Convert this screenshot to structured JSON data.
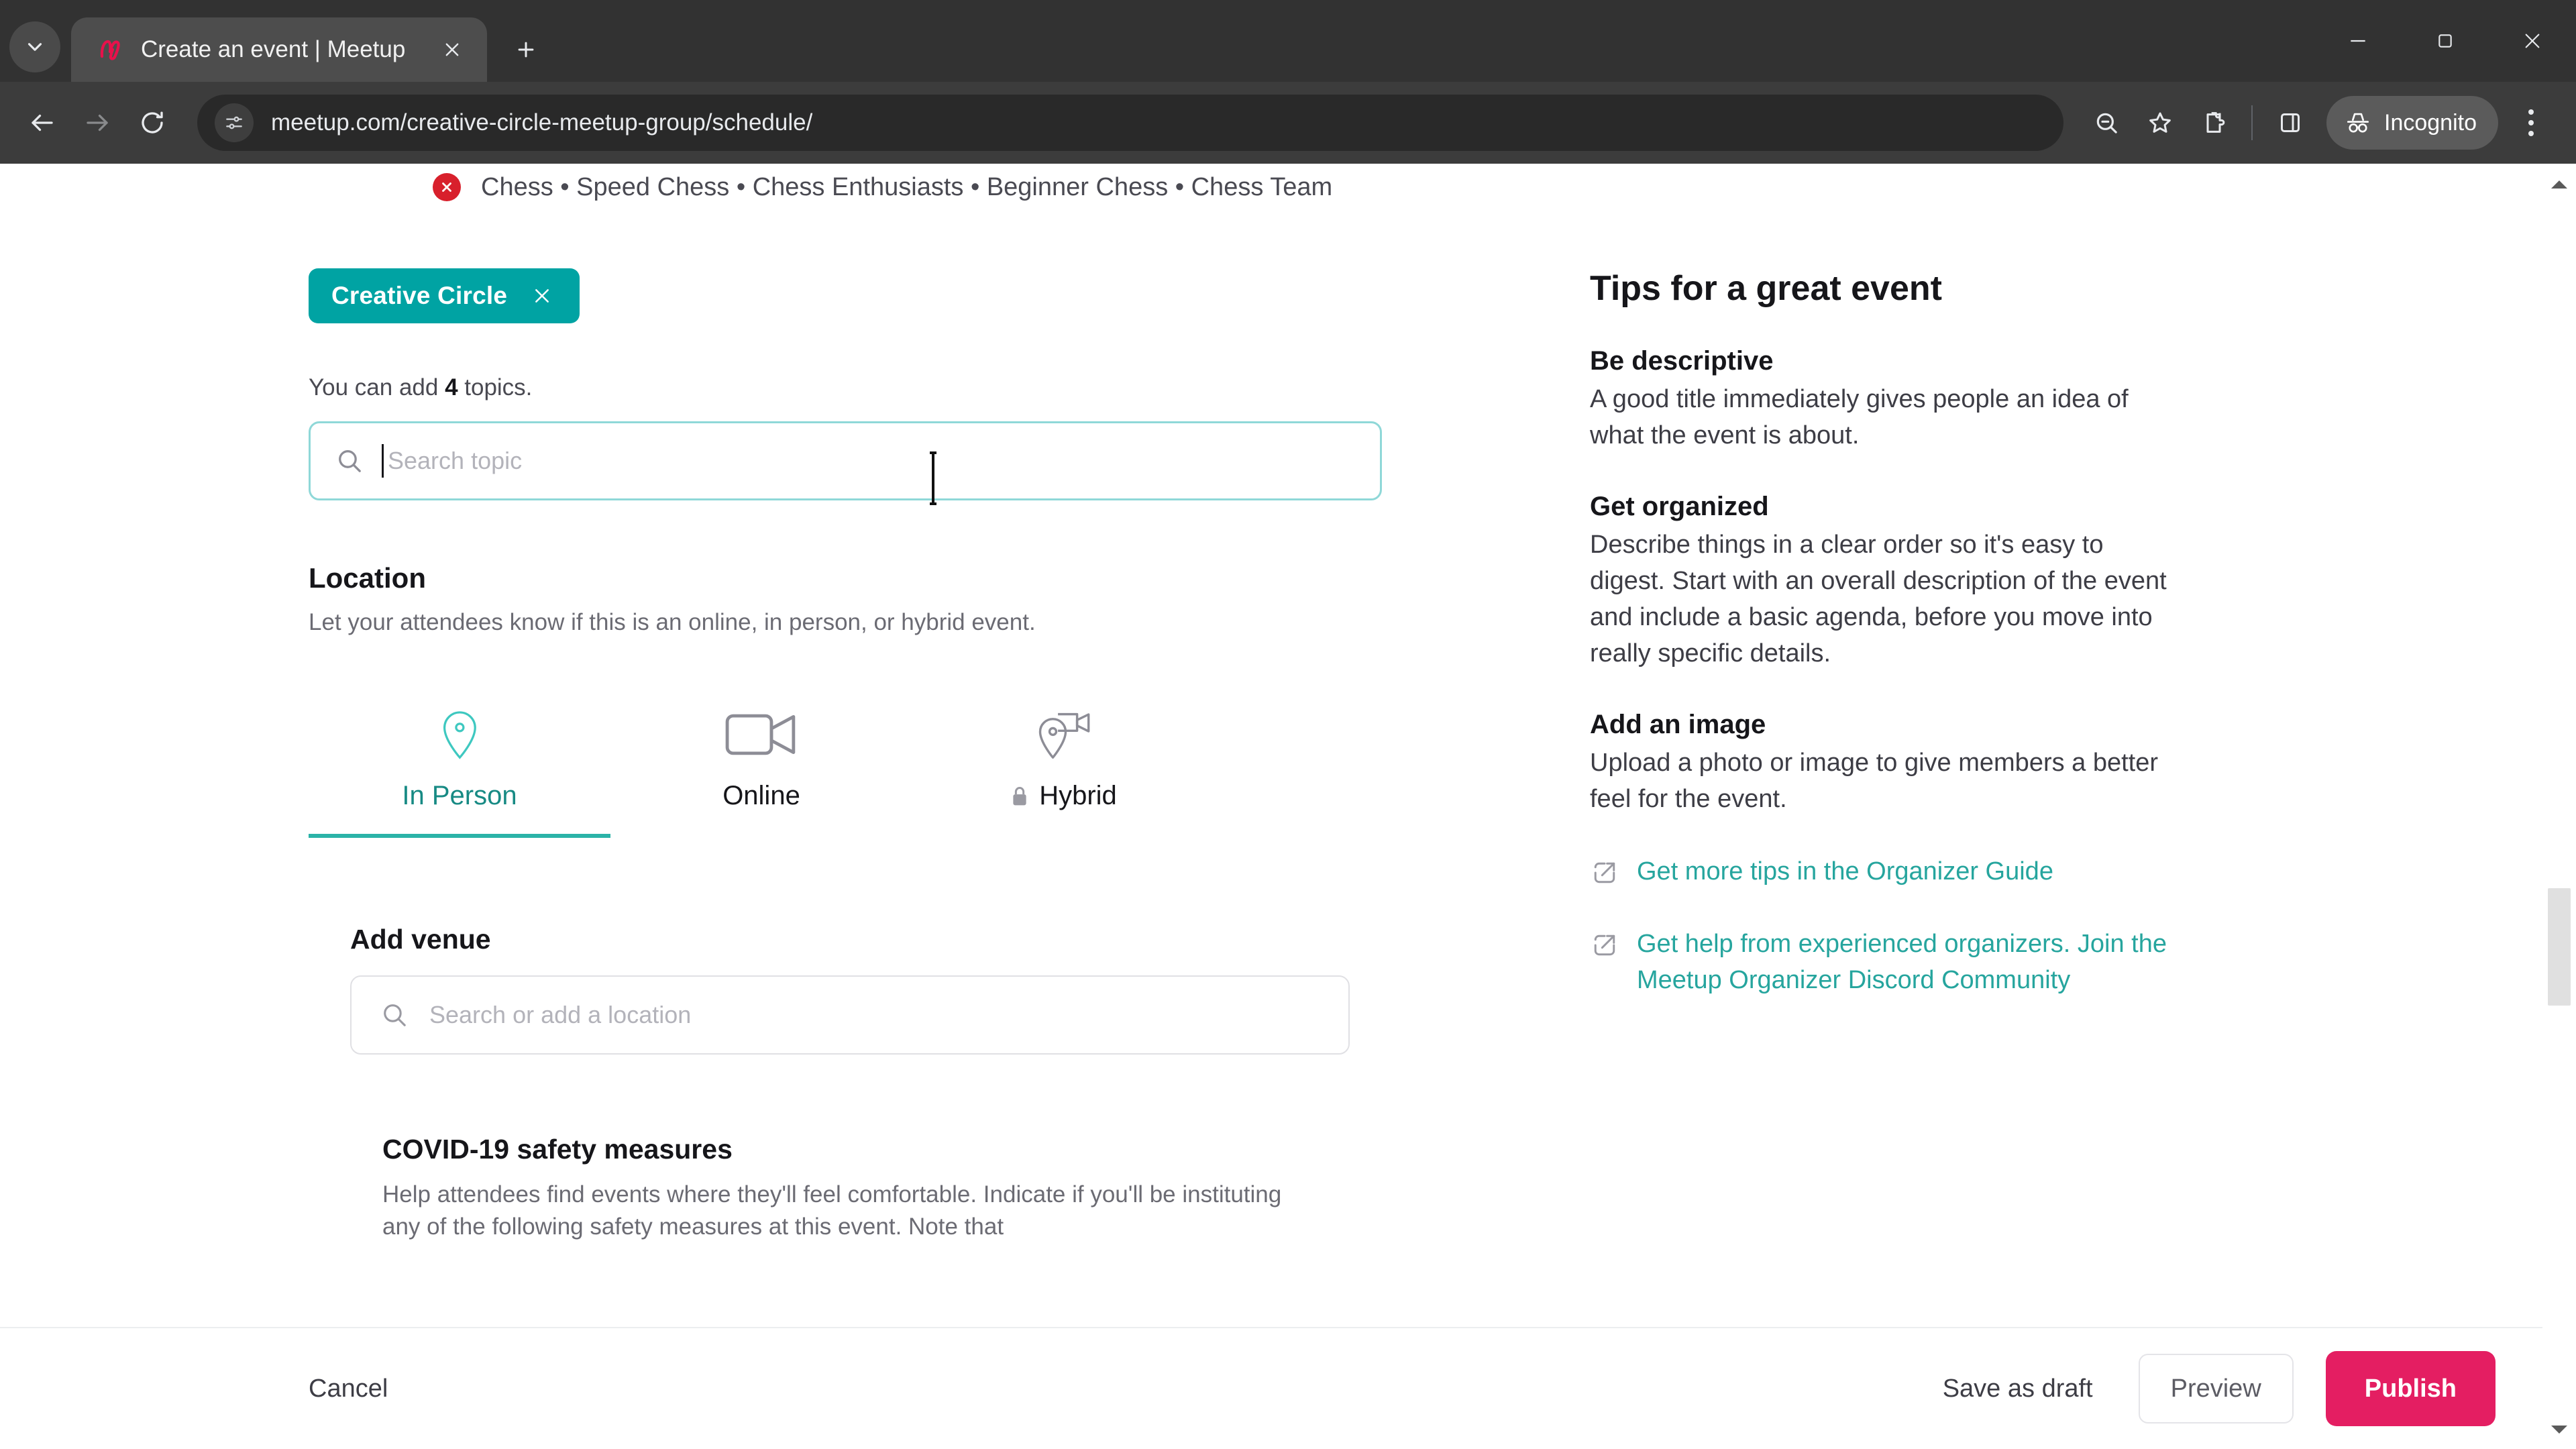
{
  "browser": {
    "tab": {
      "title": "Create an event | Meetup",
      "favicon": "meetup-logo-icon"
    },
    "tab_search_icon": "chevron-down-icon",
    "new_tab_icon": "plus-icon",
    "tab_close_icon": "close-icon",
    "window": {
      "minimize_icon": "minimize-icon",
      "maximize_icon": "maximize-icon",
      "close_icon": "window-close-icon"
    },
    "nav": {
      "back_icon": "back-arrow-icon",
      "forward_icon": "forward-arrow-icon",
      "reload_icon": "reload-icon"
    },
    "omnibox": {
      "url": "meetup.com/creative-circle-meetup-group/schedule/",
      "site_info_icon": "tune-settings-icon"
    },
    "actions": {
      "zoom_out_icon": "zoom-out-icon",
      "bookmark_icon": "star-icon",
      "extensions_icon": "extensions-puzzle-icon",
      "side_panel_icon": "side-panel-icon",
      "incognito_label": "Incognito",
      "incognito_icon": "incognito-hat-glasses-icon",
      "menu_icon": "three-dot-menu-icon"
    }
  },
  "page": {
    "error_banner": {
      "icon": "error-x-icon",
      "text": "Chess • Speed Chess • Chess Enthusiasts • Beginner Chess • Chess Team"
    },
    "topics": {
      "chip_label": "Creative Circle",
      "chip_remove_icon": "close-icon",
      "note_prefix": "You can add ",
      "note_count": "4",
      "note_suffix": " topics.",
      "search_placeholder": "Search topic",
      "search_value": "",
      "search_icon": "search-icon"
    },
    "location": {
      "title": "Location",
      "description": "Let your attendees know if this is an online, in person, or hybrid event.",
      "tabs": [
        {
          "label": "In Person",
          "icon": "map-pin-icon",
          "active": true,
          "locked": false
        },
        {
          "label": "Online",
          "icon": "video-camera-icon",
          "active": false,
          "locked": false
        },
        {
          "label": "Hybrid",
          "icon": "pin-camera-icon",
          "active": false,
          "locked": true
        }
      ]
    },
    "venue": {
      "title": "Add venue",
      "placeholder": "Search or add a location",
      "value": "",
      "search_icon": "search-icon"
    },
    "covid": {
      "title": "COVID-19 safety measures",
      "description": "Help attendees find events where they'll feel comfortable. Indicate if you'll be instituting any of the following safety measures at this event. Note that"
    },
    "sidebar": {
      "heading": "Tips for a great event",
      "tips": [
        {
          "heading": "Be descriptive",
          "body": "A good title immediately gives people an idea of what the event is about."
        },
        {
          "heading": "Get organized",
          "body": "Describe things in a clear order so it's easy to digest. Start with an overall description of the event and include a basic agenda, before you move into really specific details."
        },
        {
          "heading": "Add an image",
          "body": "Upload a photo or image to give members a better feel for the event."
        }
      ],
      "links": [
        {
          "text": "Get more tips in the Organizer Guide",
          "icon": "external-link-icon"
        },
        {
          "text": "Get help from experienced organizers. Join the Meetup Organizer Discord Community",
          "icon": "external-link-icon"
        }
      ]
    },
    "footer": {
      "cancel_label": "Cancel",
      "save_draft_label": "Save as draft",
      "preview_label": "Preview",
      "publish_label": "Publish"
    },
    "scrollbar": {
      "up_icon": "scroll-up-arrow-icon",
      "down_icon": "scroll-down-arrow-icon"
    }
  },
  "colors": {
    "teal": "#00a3a3",
    "teal_active": "#2bb3a8",
    "link_teal": "#26a59e",
    "publish_pink": "#e41e62",
    "error_red": "#d8202c"
  }
}
